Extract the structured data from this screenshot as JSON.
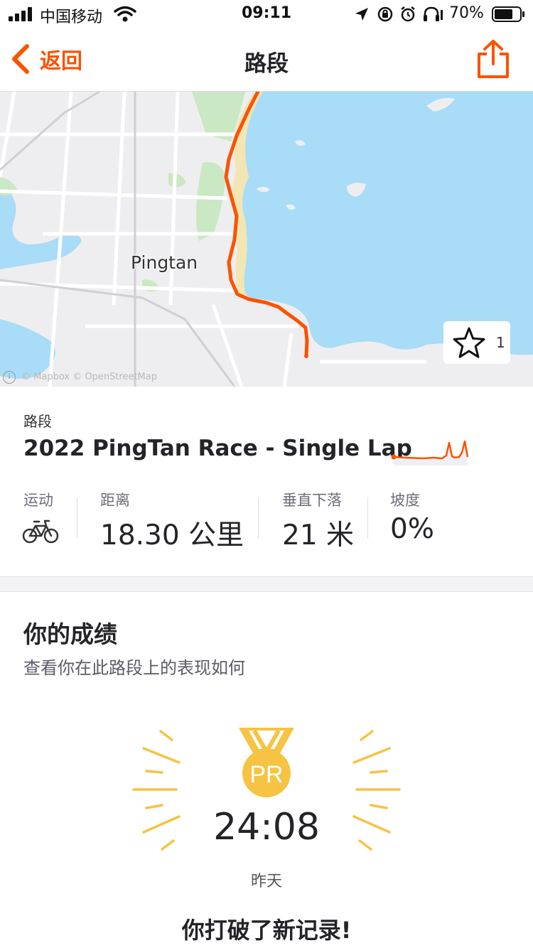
{
  "status_bar": {
    "carrier": "中国移动",
    "time": "09:11",
    "battery": "70%"
  },
  "nav": {
    "back_label": "返回",
    "title": "路段"
  },
  "map": {
    "city_label": "Pingtan",
    "attribution": "© Mapbox © OpenStreetMap",
    "star_count": "1",
    "route_color": "#fc5200",
    "water_color": "#a8dcf7"
  },
  "segment": {
    "type_label": "路段",
    "name": "2022 PingTan Race - Single Lap",
    "stats": [
      {
        "label": "运动",
        "icon": "bike-icon"
      },
      {
        "label": "距离",
        "value": "18.30 公里"
      },
      {
        "label": "垂直下落",
        "value": "21 米"
      },
      {
        "label": "坡度",
        "value": "0%"
      }
    ]
  },
  "results": {
    "title": "你的成绩",
    "subtitle": "查看你在此路段上的表现如何",
    "badge": "PR",
    "time": "24:08",
    "when": "昨天",
    "message": "你打破了新记录!"
  },
  "colors": {
    "accent": "#fc5200",
    "medal_gold": "#f6c343"
  }
}
